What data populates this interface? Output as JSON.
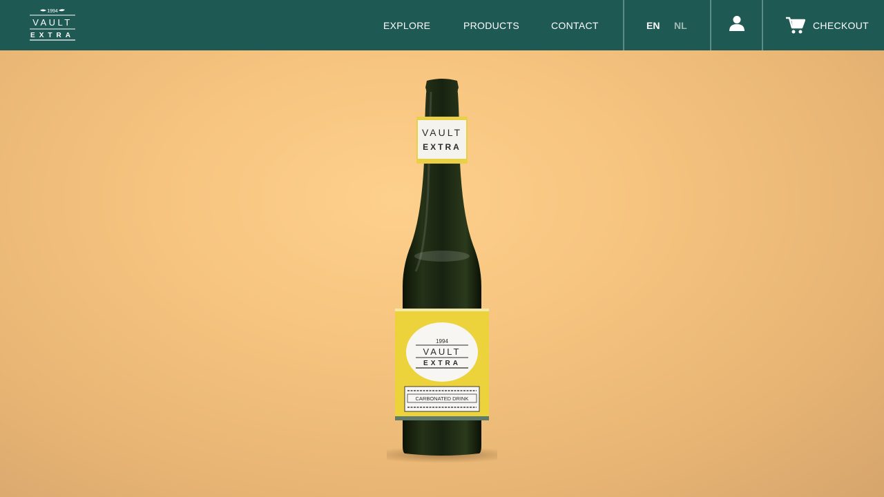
{
  "header": {
    "logo": {
      "year": "1994",
      "line1": "VAULT",
      "line2": "EXTRA"
    },
    "nav": [
      {
        "label": "EXPLORE"
      },
      {
        "label": "PRODUCTS"
      },
      {
        "label": "CONTACT"
      }
    ],
    "languages": [
      {
        "label": "EN",
        "active": true
      },
      {
        "label": "NL",
        "active": false
      }
    ],
    "user_icon": "user-icon",
    "checkout": {
      "icon": "cart-icon",
      "label": "CHECKOUT"
    }
  },
  "hero": {
    "bottle": {
      "neck_label": {
        "line1": "VAULT",
        "line2": "EXTRA"
      },
      "body_label": {
        "year": "1994",
        "line1": "VAULT",
        "line2": "EXTRA",
        "type": "CARBONATED DRINK"
      }
    }
  },
  "colors": {
    "header_bg": "#1f5953",
    "background": "#f6c47f",
    "label_yellow": "#ecd33c",
    "bottle_glass": "#1e2a10"
  }
}
